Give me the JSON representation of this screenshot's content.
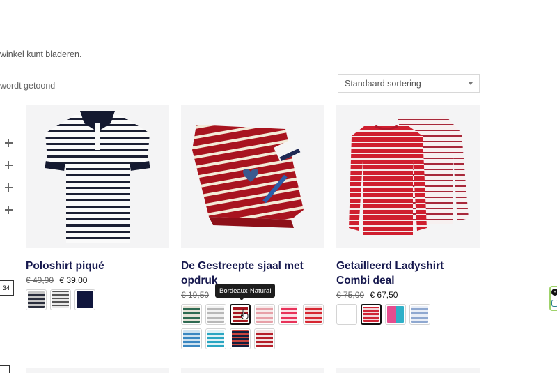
{
  "intro_text": "winkel kunt bladeren.",
  "result_count": "wordt getoond",
  "sorting": {
    "selected": "Standaard sortering"
  },
  "filters": {
    "count": 4
  },
  "side_badge": "34",
  "tooltip": "Bordeaux-Natural",
  "products": [
    {
      "title": "Poloshirt piqué",
      "old_price": "€ 49,90",
      "new_price": "€ 39,00",
      "swatches": [
        {
          "c1": "#2b2f3e",
          "c2": "#c7c7c7"
        },
        {
          "c1": "#e9e9e9",
          "c2": "#555555"
        },
        {
          "c1": "#10163d",
          "c2": "#10163d"
        }
      ]
    },
    {
      "title": "De Gestreepte sjaal met opdruk",
      "old_price": "€ 19,50",
      "new_price": "",
      "swatches": [
        {
          "c1": "#2f6a52",
          "c2": "#e6e2d6"
        },
        {
          "c1": "#b8b8b8",
          "c2": "#f2f2f2"
        },
        {
          "c1": "#a5151f",
          "c2": "#efe7d6"
        },
        {
          "c1": "#e7a0a8",
          "c2": "#f7eaea"
        },
        {
          "c1": "#e8335a",
          "c2": "#fbe2e7"
        },
        {
          "c1": "#d62631",
          "c2": "#f3d7d9"
        },
        {
          "c1": "#3b87c1",
          "c2": "#cfe2f0"
        },
        {
          "c1": "#2aa6c2",
          "c2": "#dff2f6"
        },
        {
          "c1": "#13203e",
          "c2": "#c9453f"
        },
        {
          "c1": "#b51f2a",
          "c2": "#f2e3e3"
        }
      ]
    },
    {
      "title": "Getailleerd Ladyshirt Combi deal",
      "old_price": "€ 75,00",
      "new_price": "€ 67,50",
      "swatches": [
        {
          "c1": "#2b3050",
          "c2": "#d9d9d9"
        },
        {
          "c1": "#cf2335",
          "c2": "#f3d6d9"
        },
        {
          "c1": "#e54d8f",
          "c2": "#2fb0c8"
        },
        {
          "c1": "#8fa8d0",
          "c2": "#e9eef7"
        }
      ]
    }
  ]
}
